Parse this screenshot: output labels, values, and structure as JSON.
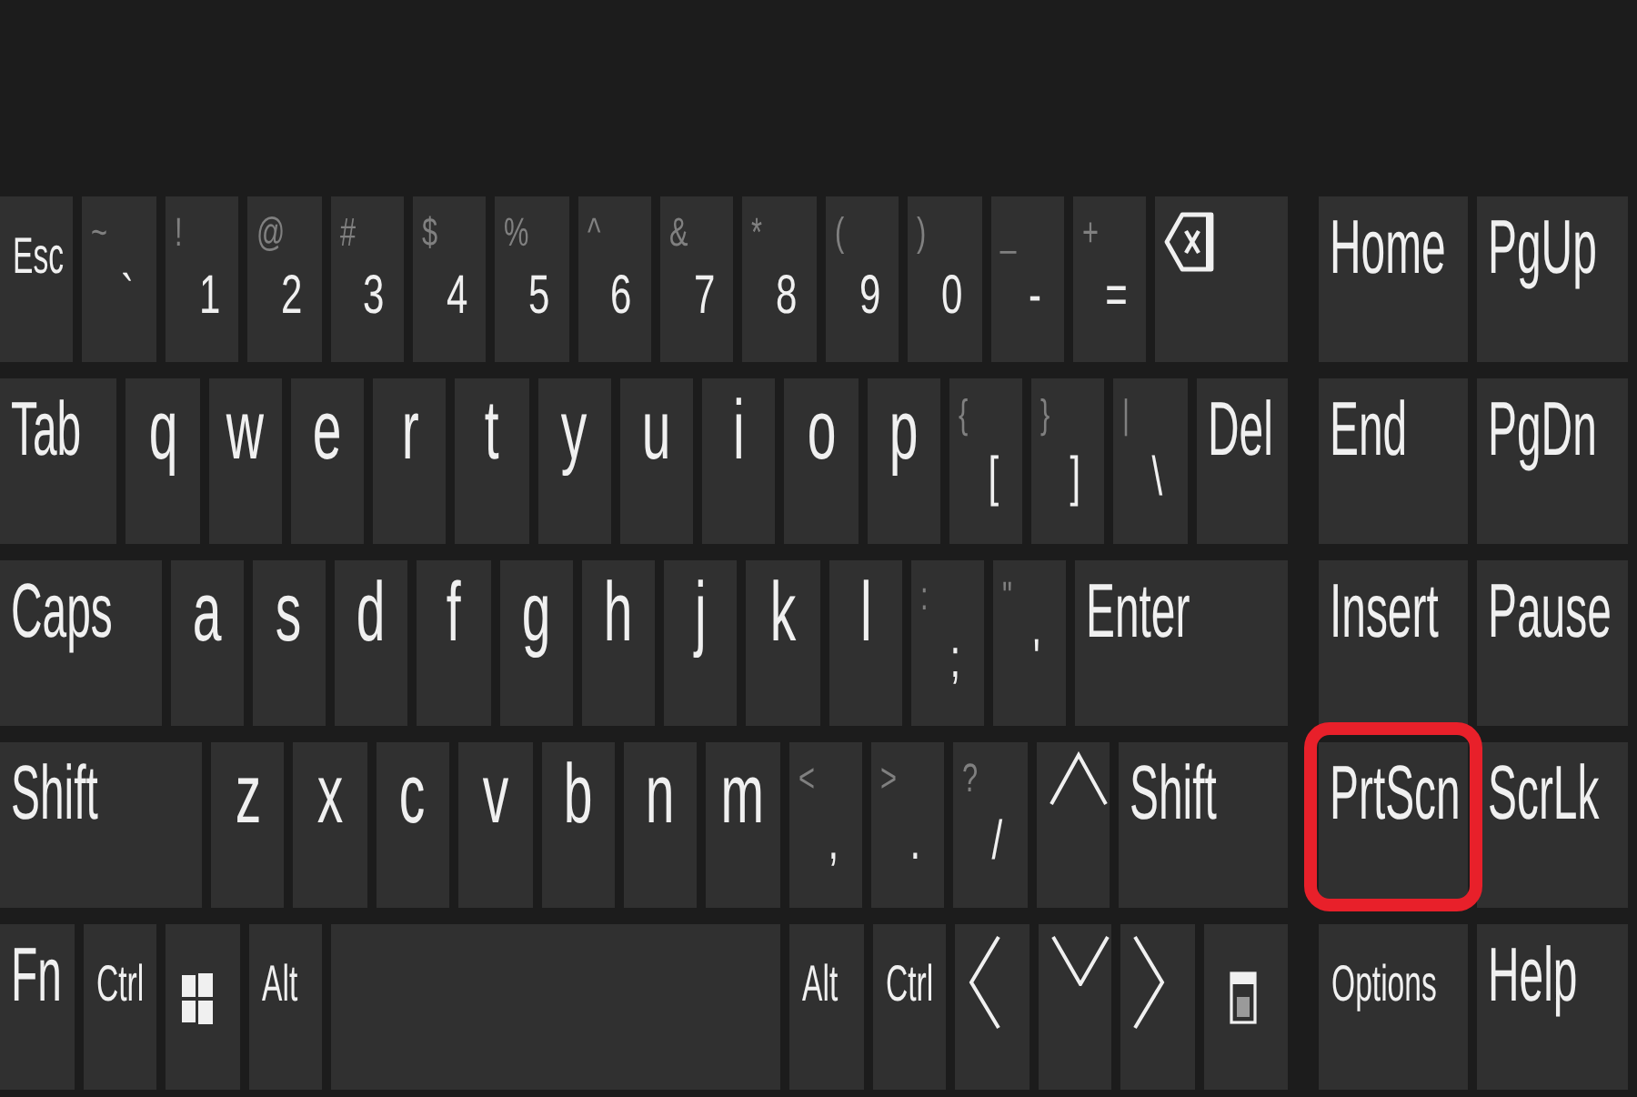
{
  "keyboard": {
    "main_rows": [
      [
        {
          "kind": "small",
          "label": "Esc"
        },
        {
          "kind": "dual",
          "shift": "~",
          "label": "`"
        },
        {
          "kind": "dual",
          "shift": "!",
          "label": "1"
        },
        {
          "kind": "dual",
          "shift": "@",
          "label": "2"
        },
        {
          "kind": "dual",
          "shift": "#",
          "label": "3"
        },
        {
          "kind": "dual",
          "shift": "$",
          "label": "4"
        },
        {
          "kind": "dual",
          "shift": "%",
          "label": "5"
        },
        {
          "kind": "dual",
          "shift": "^",
          "label": "6"
        },
        {
          "kind": "dual",
          "shift": "&",
          "label": "7"
        },
        {
          "kind": "dual",
          "shift": "*",
          "label": "8"
        },
        {
          "kind": "dual",
          "shift": "(",
          "label": "9"
        },
        {
          "kind": "dual",
          "shift": ")",
          "label": "0"
        },
        {
          "kind": "dual",
          "shift": "_",
          "label": "-"
        },
        {
          "kind": "dual",
          "shift": "+",
          "label": "="
        },
        {
          "kind": "backspace"
        }
      ],
      [
        {
          "kind": "word",
          "label": "Tab"
        },
        {
          "kind": "letter",
          "label": "q"
        },
        {
          "kind": "letter",
          "label": "w"
        },
        {
          "kind": "letter",
          "label": "e"
        },
        {
          "kind": "letter",
          "label": "r"
        },
        {
          "kind": "letter",
          "label": "t"
        },
        {
          "kind": "letter",
          "label": "y"
        },
        {
          "kind": "letter",
          "label": "u"
        },
        {
          "kind": "letter",
          "label": "i"
        },
        {
          "kind": "letter",
          "label": "o"
        },
        {
          "kind": "letter",
          "label": "p"
        },
        {
          "kind": "dual",
          "shift": "{",
          "label": "["
        },
        {
          "kind": "dual",
          "shift": "}",
          "label": "]"
        },
        {
          "kind": "dual",
          "shift": "|",
          "label": "\\"
        },
        {
          "kind": "word",
          "label": "Del"
        }
      ],
      [
        {
          "kind": "word",
          "label": "Caps"
        },
        {
          "kind": "letter",
          "label": "a"
        },
        {
          "kind": "letter",
          "label": "s"
        },
        {
          "kind": "letter",
          "label": "d"
        },
        {
          "kind": "letter",
          "label": "f"
        },
        {
          "kind": "letter",
          "label": "g"
        },
        {
          "kind": "letter",
          "label": "h"
        },
        {
          "kind": "letter",
          "label": "j"
        },
        {
          "kind": "letter",
          "label": "k"
        },
        {
          "kind": "letter",
          "label": "l"
        },
        {
          "kind": "dual",
          "shift": ":",
          "label": ";"
        },
        {
          "kind": "dual",
          "shift": "\"",
          "label": "'"
        },
        {
          "kind": "word",
          "label": "Enter"
        }
      ],
      [
        {
          "kind": "word",
          "label": "Shift"
        },
        {
          "kind": "letter",
          "label": "z"
        },
        {
          "kind": "letter",
          "label": "x"
        },
        {
          "kind": "letter",
          "label": "c"
        },
        {
          "kind": "letter",
          "label": "v"
        },
        {
          "kind": "letter",
          "label": "b"
        },
        {
          "kind": "letter",
          "label": "n"
        },
        {
          "kind": "letter",
          "label": "m"
        },
        {
          "kind": "dual",
          "shift": "<",
          "label": ","
        },
        {
          "kind": "dual",
          "shift": ">",
          "label": "."
        },
        {
          "kind": "dual",
          "shift": "?",
          "label": "/"
        },
        {
          "kind": "up"
        },
        {
          "kind": "word",
          "label": "Shift"
        }
      ],
      [
        {
          "kind": "word",
          "label": "Fn"
        },
        {
          "kind": "small",
          "label": "Ctrl"
        },
        {
          "kind": "windows"
        },
        {
          "kind": "small",
          "label": "Alt"
        },
        {
          "kind": "space"
        },
        {
          "kind": "small",
          "label": "Alt"
        },
        {
          "kind": "small",
          "label": "Ctrl"
        },
        {
          "kind": "left"
        },
        {
          "kind": "down"
        },
        {
          "kind": "right"
        },
        {
          "kind": "menu"
        }
      ]
    ],
    "nav_keys": [
      {
        "kind": "word",
        "label": "Home",
        "highlighted": false
      },
      {
        "kind": "word",
        "label": "PgUp",
        "highlighted": false
      },
      {
        "kind": "word",
        "label": "End",
        "highlighted": false
      },
      {
        "kind": "word",
        "label": "PgDn",
        "highlighted": false
      },
      {
        "kind": "word",
        "label": "Insert",
        "highlighted": false
      },
      {
        "kind": "word",
        "label": "Pause",
        "highlighted": false
      },
      {
        "kind": "word",
        "label": "PrtScn",
        "highlighted": true
      },
      {
        "kind": "word",
        "label": "ScrLk",
        "highlighted": false
      },
      {
        "kind": "small",
        "label": "Options",
        "highlighted": false
      },
      {
        "kind": "word",
        "label": "Help",
        "highlighted": false
      }
    ]
  }
}
